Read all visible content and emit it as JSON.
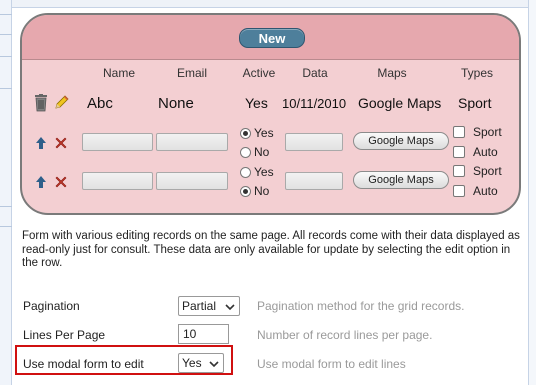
{
  "preview": {
    "new_button": "New",
    "columns": [
      "Name",
      "Email",
      "Active",
      "Data",
      "Maps",
      "Types"
    ],
    "readonly_row": {
      "name": "Abc",
      "email": "None",
      "active": "Yes",
      "data": "10/11/2010",
      "maps": "Google Maps",
      "types": "Sport"
    },
    "edit_rows": [
      {
        "radio_yes": "Yes",
        "radio_no": "No",
        "selected": "Yes",
        "maps_button": "Google Maps",
        "check1": "Sport",
        "check2": "Auto"
      },
      {
        "radio_yes": "Yes",
        "radio_no": "No",
        "selected": "No",
        "maps_button": "Google Maps",
        "check1": "Sport",
        "check2": "Auto"
      }
    ]
  },
  "description": "Form with various editing records on the same page. All records come with their data displayed as read-only just for consult. These data are only available for update by selecting the edit option in the row.",
  "options": {
    "pagination": {
      "label": "Pagination",
      "value": "Partial",
      "hint": "Pagination method for the grid records."
    },
    "lines_per_page": {
      "label": "Lines Per Page",
      "value": "10",
      "hint": "Number of record lines per page."
    },
    "modal_form": {
      "label": "Use modal form to edit",
      "value": "Yes",
      "hint": "Use modal form to edit lines"
    }
  },
  "colors": {
    "panel_bg": "#f3cfd2",
    "panel_header": "#e6a8ae",
    "new_button": "#4e7f9b",
    "highlight": "#d01010"
  }
}
